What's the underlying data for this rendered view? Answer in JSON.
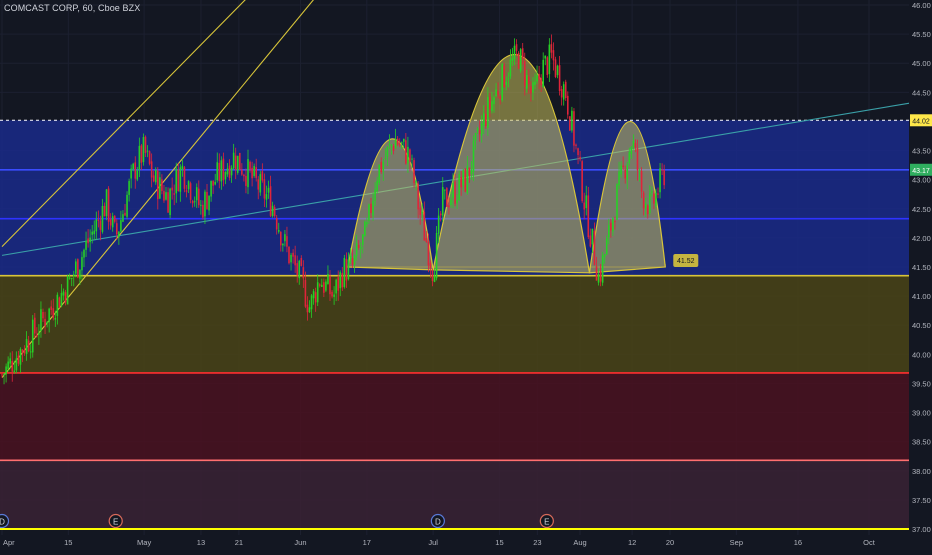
{
  "header": {
    "symbol_title": "COMCAST CORP, 60, Cboe BZX"
  },
  "colors": {
    "background": "#131722",
    "grid": "#1c2030",
    "up": "#26d126",
    "down": "#e0243a",
    "yellow_line": "#d8c53a",
    "blue_line": "#2e33ff",
    "red_line": "#ff2f2f",
    "pattern_fill": "#c8c05a",
    "price_label_bg": "#ffe84a",
    "text": "#b2b5be"
  },
  "chart_data": {
    "type": "candlestick",
    "title": "COMCAST CORP, 60, Cboe BZX",
    "x_tick_labels": [
      "Apr",
      "15",
      "May",
      "13",
      "21",
      "Jun",
      "17",
      "Jul",
      "15",
      "23",
      "Aug",
      "12",
      "20",
      "Sep",
      "16",
      "Oct"
    ],
    "y_tick_labels": [
      "37.00",
      "37.50",
      "38.00",
      "38.50",
      "39.00",
      "39.50",
      "40.00",
      "40.50",
      "41.00",
      "41.50",
      "42.00",
      "42.50",
      "43.00",
      "43.50",
      "44.00",
      "44.50",
      "45.00",
      "45.50",
      "46.00"
    ],
    "ylim": [
      36.92,
      46.08
    ],
    "price_labels": [
      {
        "id": "resistance",
        "price": 44.02,
        "text": "44.02"
      },
      {
        "id": "last",
        "price": 43.17,
        "text": "43.17"
      },
      {
        "id": "neckline",
        "price": 41.52,
        "text": "41.52"
      }
    ],
    "event_markers": [
      {
        "label": "D",
        "x": "Apr 1"
      },
      {
        "label": "E",
        "x": "Apr 25"
      },
      {
        "label": "D",
        "x": "Jul 2"
      },
      {
        "label": "E",
        "x": "Jul 25"
      }
    ],
    "zones": [
      {
        "name": "blue zone",
        "from": 41.35,
        "to": 44.02,
        "color": "#1a2a8a"
      },
      {
        "name": "olive zone",
        "from": 39.68,
        "to": 41.35,
        "color": "#4a4416"
      },
      {
        "name": "red zone",
        "from": 38.18,
        "to": 39.68,
        "color": "#4a1220"
      },
      {
        "name": "mauve zone",
        "from": 37.0,
        "to": 38.18,
        "color": "#3a2234"
      }
    ],
    "horizontal_lines": [
      {
        "price": 44.02,
        "style": "dashed",
        "color": "#ffffff"
      },
      {
        "price": 43.17,
        "style": "solid",
        "color": "#3a4cff"
      },
      {
        "price": 42.33,
        "style": "solid",
        "color": "#2e33ff"
      },
      {
        "price": 41.35,
        "style": "solid",
        "color": "#d8c53a"
      },
      {
        "price": 39.68,
        "style": "solid",
        "color": "#ff2f2f"
      },
      {
        "price": 38.18,
        "style": "solid",
        "color": "#ff6f6f"
      },
      {
        "price": 37.0,
        "style": "solid",
        "color": "#ffff00"
      }
    ],
    "trendlines": [
      {
        "name": "teal trend",
        "color": "#3aa0a8",
        "from": [
          "Apr 1",
          41.7
        ],
        "to": [
          "Oct 10",
          44.32
        ]
      },
      {
        "name": "yellow channel lower",
        "color": "#d8c53a",
        "from": [
          "Apr 1",
          39.6
        ],
        "to": [
          "Jun 18",
          47.3
        ]
      },
      {
        "name": "yellow channel upper",
        "color": "#d8c53a",
        "from": [
          "Apr 1",
          41.85
        ],
        "to": [
          "Jun 6",
          47.3
        ]
      }
    ],
    "pattern": {
      "type": "head and shoulders",
      "left_shoulder": {
        "start": [
          "Jun 13",
          41.5
        ],
        "peak": [
          "Jun 23",
          43.7
        ],
        "end": [
          "Jul 1",
          41.45
        ]
      },
      "head": {
        "start": [
          "Jul 1",
          41.45
        ],
        "peak": [
          "Jul 19",
          45.15
        ],
        "end": [
          "Aug 3",
          41.4
        ]
      },
      "right_shoulder": {
        "start": [
          "Aug 3",
          41.4
        ],
        "peak": [
          "Aug 12",
          44.0
        ],
        "end": [
          "Aug 19",
          41.5
        ]
      }
    },
    "price_path": [
      [
        "Apr 1",
        39.65
      ],
      [
        "Apr 8",
        40.4
      ],
      [
        "Apr 15",
        41.2
      ],
      [
        "Apr 19",
        41.9
      ],
      [
        "Apr 23",
        42.6
      ],
      [
        "Apr 25",
        42.0
      ],
      [
        "Apr 29",
        43.2
      ],
      [
        "May 1",
        43.5
      ],
      [
        "May 3",
        43.0
      ],
      [
        "May 6",
        42.7
      ],
      [
        "May 9",
        43.2
      ],
      [
        "May 13",
        42.5
      ],
      [
        "May 16",
        43.0
      ],
      [
        "May 20",
        43.4
      ],
      [
        "May 23",
        43.1
      ],
      [
        "May 28",
        42.6
      ],
      [
        "May 31",
        41.8
      ],
      [
        "Jun 3",
        41.3
      ],
      [
        "Jun 5",
        40.8
      ],
      [
        "Jun 7",
        41.3
      ],
      [
        "Jun 10",
        41.0
      ],
      [
        "Jun 12",
        41.45
      ],
      [
        "Jun 14",
        41.5
      ],
      [
        "Jun 17",
        42.1
      ],
      [
        "Jun 19",
        43.1
      ],
      [
        "Jun 23",
        43.7
      ],
      [
        "Jun 26",
        43.4
      ],
      [
        "Jun 28",
        42.5
      ],
      [
        "Jul 1",
        41.45
      ],
      [
        "Jul 3",
        42.6
      ],
      [
        "Jul 8",
        43.0
      ],
      [
        "Jul 12",
        44.1
      ],
      [
        "Jul 16",
        44.8
      ],
      [
        "Jul 19",
        45.15
      ],
      [
        "Jul 22",
        44.4
      ],
      [
        "Jul 24",
        44.9
      ],
      [
        "Jul 26",
        45.1
      ],
      [
        "Jul 29",
        44.5
      ],
      [
        "Jul 31",
        43.6
      ],
      [
        "Aug 2",
        42.6
      ],
      [
        "Aug 5",
        41.3
      ],
      [
        "Aug 7",
        42.0
      ],
      [
        "Aug 9",
        42.8
      ],
      [
        "Aug 12",
        43.7
      ],
      [
        "Aug 14",
        42.8
      ],
      [
        "Aug 16",
        42.5
      ],
      [
        "Aug 19",
        43.17
      ]
    ]
  }
}
